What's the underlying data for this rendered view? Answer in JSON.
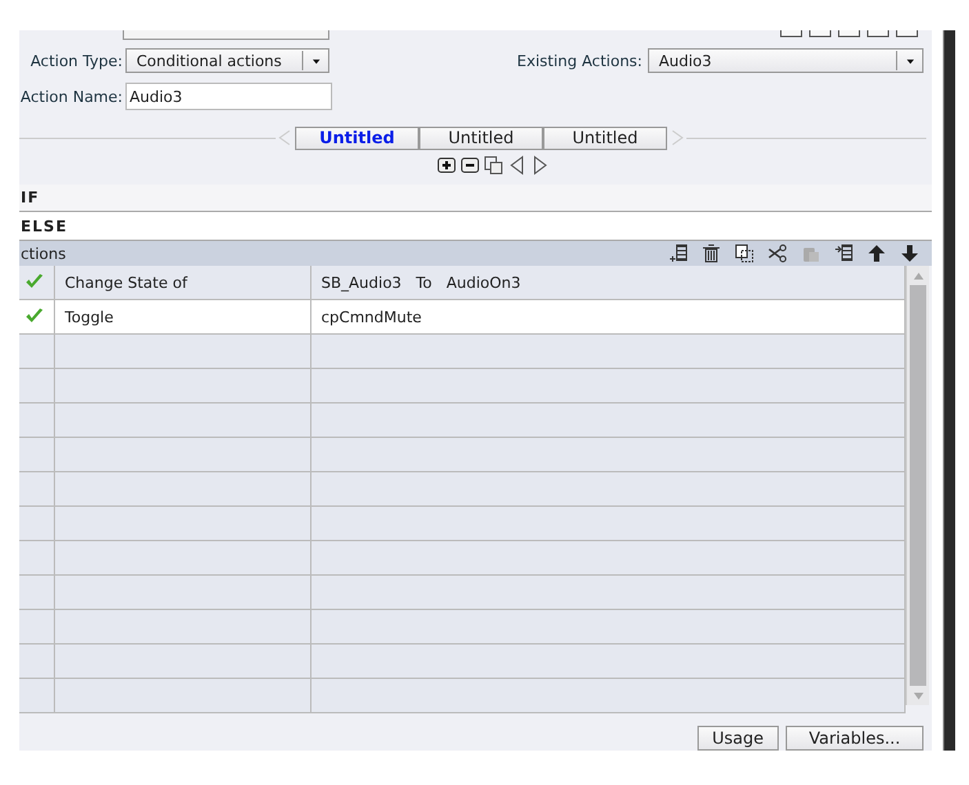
{
  "form": {
    "action_type_label": "Action Type:",
    "action_type_value": "Conditional actions",
    "action_name_label": "Action Name:",
    "action_name_value": "Audio3",
    "existing_actions_label": "Existing Actions:",
    "existing_actions_value": "Audio3"
  },
  "tabs": [
    {
      "label": "Untitled",
      "selected": true
    },
    {
      "label": "Untitled",
      "selected": false
    },
    {
      "label": "Untitled",
      "selected": false
    }
  ],
  "sections": [
    "IF",
    "ELSE"
  ],
  "actions_header": "ctions",
  "rows": [
    {
      "checked": true,
      "command": "Change State of",
      "target": "SB_Audio3   To   AudioOn3"
    },
    {
      "checked": true,
      "command": "Toggle",
      "target": "cpCmndMute"
    }
  ],
  "buttons": [
    "Usage",
    "Variables..."
  ]
}
